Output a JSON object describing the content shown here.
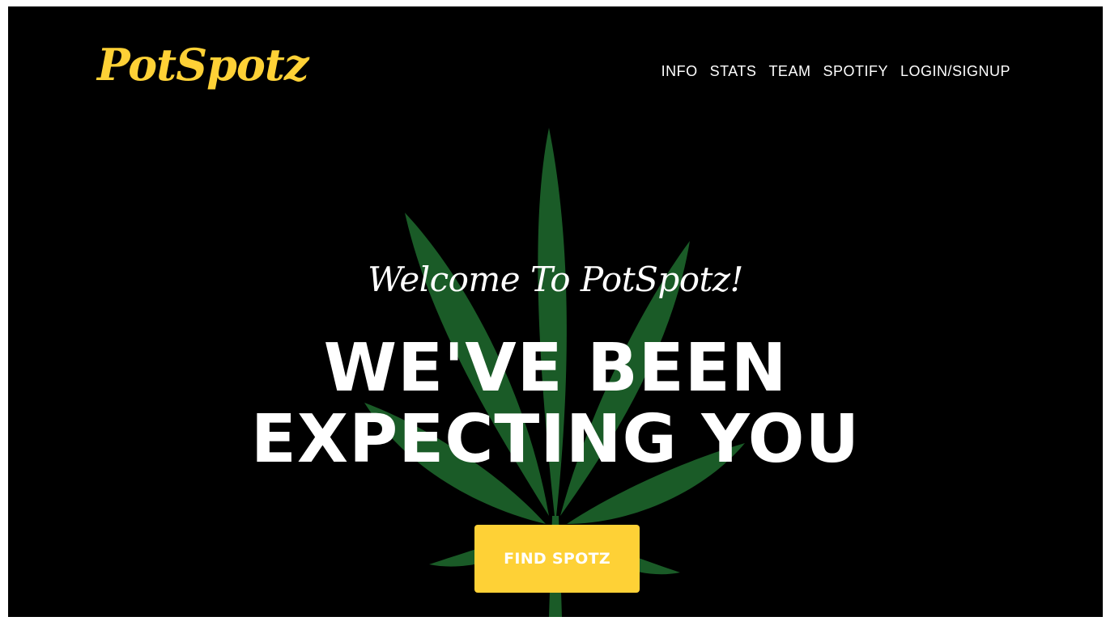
{
  "brand": {
    "name": "PotSpotz",
    "color": "#fed136"
  },
  "nav": {
    "items": [
      {
        "label": "INFO"
      },
      {
        "label": "STATS"
      },
      {
        "label": "TEAM"
      },
      {
        "label": "SPOTIFY"
      },
      {
        "label": "LOGIN/SIGNUP"
      }
    ]
  },
  "hero": {
    "subheading": "Welcome To PotSpotz!",
    "heading": "WE'VE BEEN EXPECTING YOU",
    "cta_label": "FIND SPOTZ",
    "cta_color": "#fed136",
    "background_image": "cannabis-leaf-icon",
    "leaf_color": "#1f6b2e"
  }
}
